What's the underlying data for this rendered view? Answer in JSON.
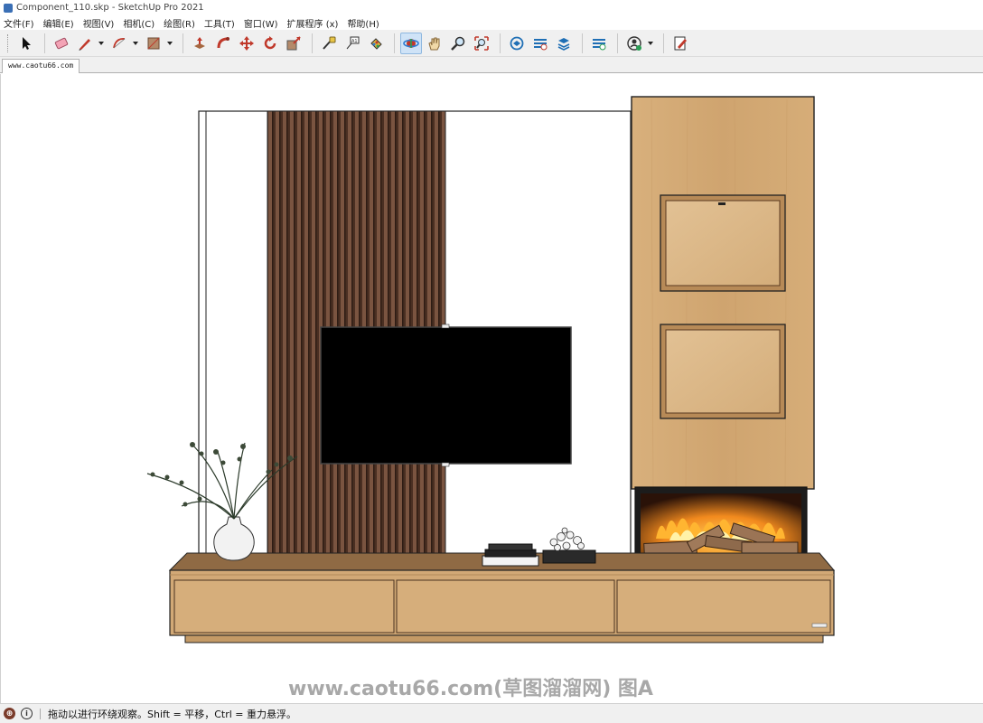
{
  "window": {
    "title": "Component_110.skp - SketchUp Pro 2021"
  },
  "menu": {
    "items": [
      {
        "label": "文件(F)"
      },
      {
        "label": "编辑(E)"
      },
      {
        "label": "视图(V)"
      },
      {
        "label": "相机(C)"
      },
      {
        "label": "绘图(R)"
      },
      {
        "label": "工具(T)"
      },
      {
        "label": "窗口(W)"
      },
      {
        "label": "扩展程序 (x)"
      },
      {
        "label": "帮助(H)"
      }
    ]
  },
  "toolbar": {
    "tools": [
      {
        "icon": "select-arrow-icon"
      },
      {
        "icon": "eraser-icon"
      },
      {
        "icon": "pencil-line-icon"
      },
      {
        "icon": "arc-icon"
      },
      {
        "icon": "rectangle-icon"
      },
      {
        "icon": "push-pull-icon"
      },
      {
        "icon": "follow-me-icon"
      },
      {
        "icon": "move-icon"
      },
      {
        "icon": "rotate-icon"
      },
      {
        "icon": "scale-icon"
      },
      {
        "icon": "tape-measure-icon"
      },
      {
        "icon": "text-label-icon"
      },
      {
        "icon": "paint-bucket-icon"
      },
      {
        "icon": "orbit-icon"
      },
      {
        "icon": "pan-hand-icon"
      },
      {
        "icon": "zoom-icon"
      },
      {
        "icon": "zoom-extents-icon"
      },
      {
        "icon": "3d-warehouse-icon"
      },
      {
        "icon": "extension-warehouse-icon"
      },
      {
        "icon": "layout-send-icon"
      },
      {
        "icon": "extension-manager-icon"
      },
      {
        "icon": "account-icon"
      },
      {
        "icon": "model-info-edit-icon"
      }
    ],
    "active_tool": "orbit-icon"
  },
  "tab": {
    "label": "www.caotu66.com"
  },
  "watermark": {
    "text": "www.caotu66.com(草图溜溜网) 图A"
  },
  "status": {
    "message": "拖动以进行环绕观察。Shift = 平移，Ctrl = 重力悬浮。"
  },
  "colors": {
    "toolbar_bg": "#f0f0f0",
    "active_tool_bg": "#cfe3f7",
    "wood_light": "#d2a976",
    "wood_dark": "#5a3a28",
    "tv_screen": "#000000",
    "flame": "#f28a1e"
  }
}
